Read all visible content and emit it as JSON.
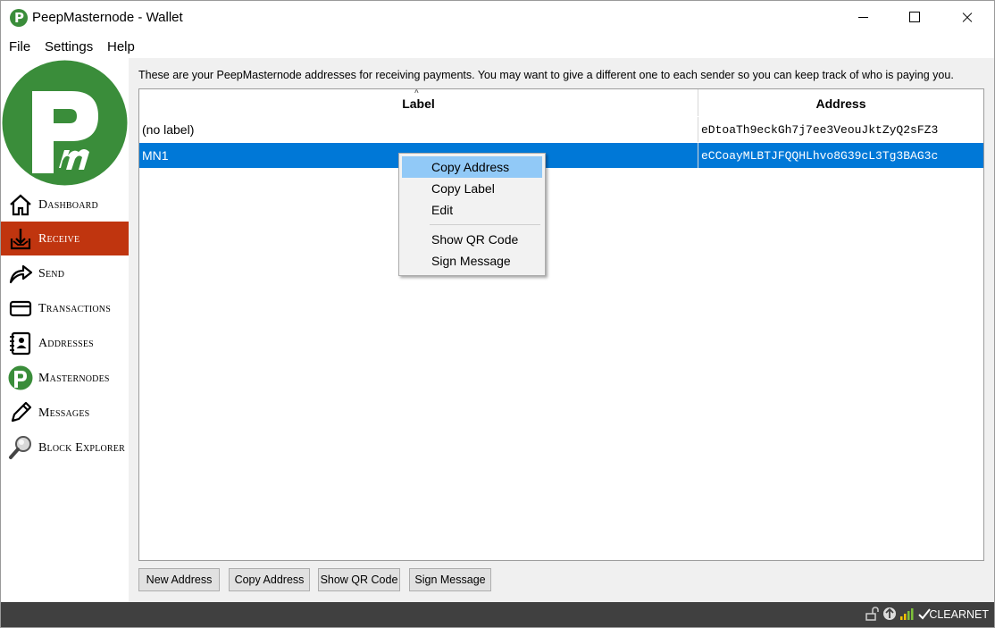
{
  "window": {
    "title": "PeepMasternode - Wallet"
  },
  "menubar": {
    "file": "File",
    "settings": "Settings",
    "help": "Help"
  },
  "sidebar": {
    "items": [
      {
        "label": "Dashboard",
        "icon": "home-icon",
        "active": false
      },
      {
        "label": "Receive",
        "icon": "receive-icon",
        "active": true
      },
      {
        "label": "Send",
        "icon": "send-arrow-icon",
        "active": false
      },
      {
        "label": "Transactions",
        "icon": "card-icon",
        "active": false
      },
      {
        "label": "Addresses",
        "icon": "address-book-icon",
        "active": false
      },
      {
        "label": "Masternodes",
        "icon": "masternode-logo-icon",
        "active": false
      },
      {
        "label": "Messages",
        "icon": "pencil-icon",
        "active": false
      },
      {
        "label": "Block Explorer",
        "icon": "magnifier-icon",
        "active": false
      }
    ]
  },
  "main": {
    "intro": "These are your PeepMasternode addresses for receiving payments. You may want to give a different one to each sender so you can keep track of who is paying you.",
    "table": {
      "columns": {
        "label": "Label",
        "address": "Address"
      },
      "rows": [
        {
          "label": "(no label)",
          "address": "eDtoaTh9eckGh7j7ee3VeouJktZyQ2sFZ3",
          "selected": false
        },
        {
          "label": "MN1",
          "address": "eCCoayMLBTJFQQHLhvo8G39cL3Tg3BAG3c",
          "selected": true
        }
      ]
    },
    "buttons": {
      "new_address": "New Address",
      "copy_address": "Copy Address",
      "show_qr": "Show QR Code",
      "sign_message": "Sign Message"
    }
  },
  "context_menu": {
    "items": [
      "Copy Address",
      "Copy Label",
      "Edit",
      "Show QR Code",
      "Sign Message"
    ],
    "hovered": "Copy Address"
  },
  "statusbar": {
    "network": "CLEARNET"
  },
  "colors": {
    "accent": "#c0350f",
    "selection": "#0078d7",
    "brand_green": "#3a8d3a",
    "menu_hover": "#91c9f7"
  }
}
